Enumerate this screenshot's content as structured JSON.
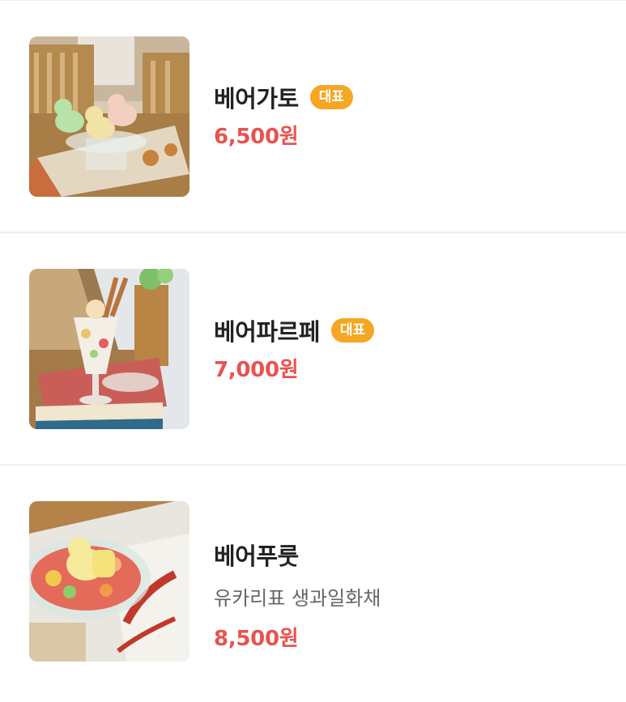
{
  "menu": {
    "items": [
      {
        "name": "베어가토",
        "badge": "대표",
        "description": "",
        "price": "6,500원"
      },
      {
        "name": "베어파르페",
        "badge": "대표",
        "description": "",
        "price": "7,000원"
      },
      {
        "name": "베어푸룻",
        "badge": "",
        "description": "유카리표 생과일화채",
        "price": "8,500원"
      }
    ]
  },
  "colors": {
    "badge": "#f5a623",
    "price": "#e8534f",
    "divider": "#eceef0"
  }
}
